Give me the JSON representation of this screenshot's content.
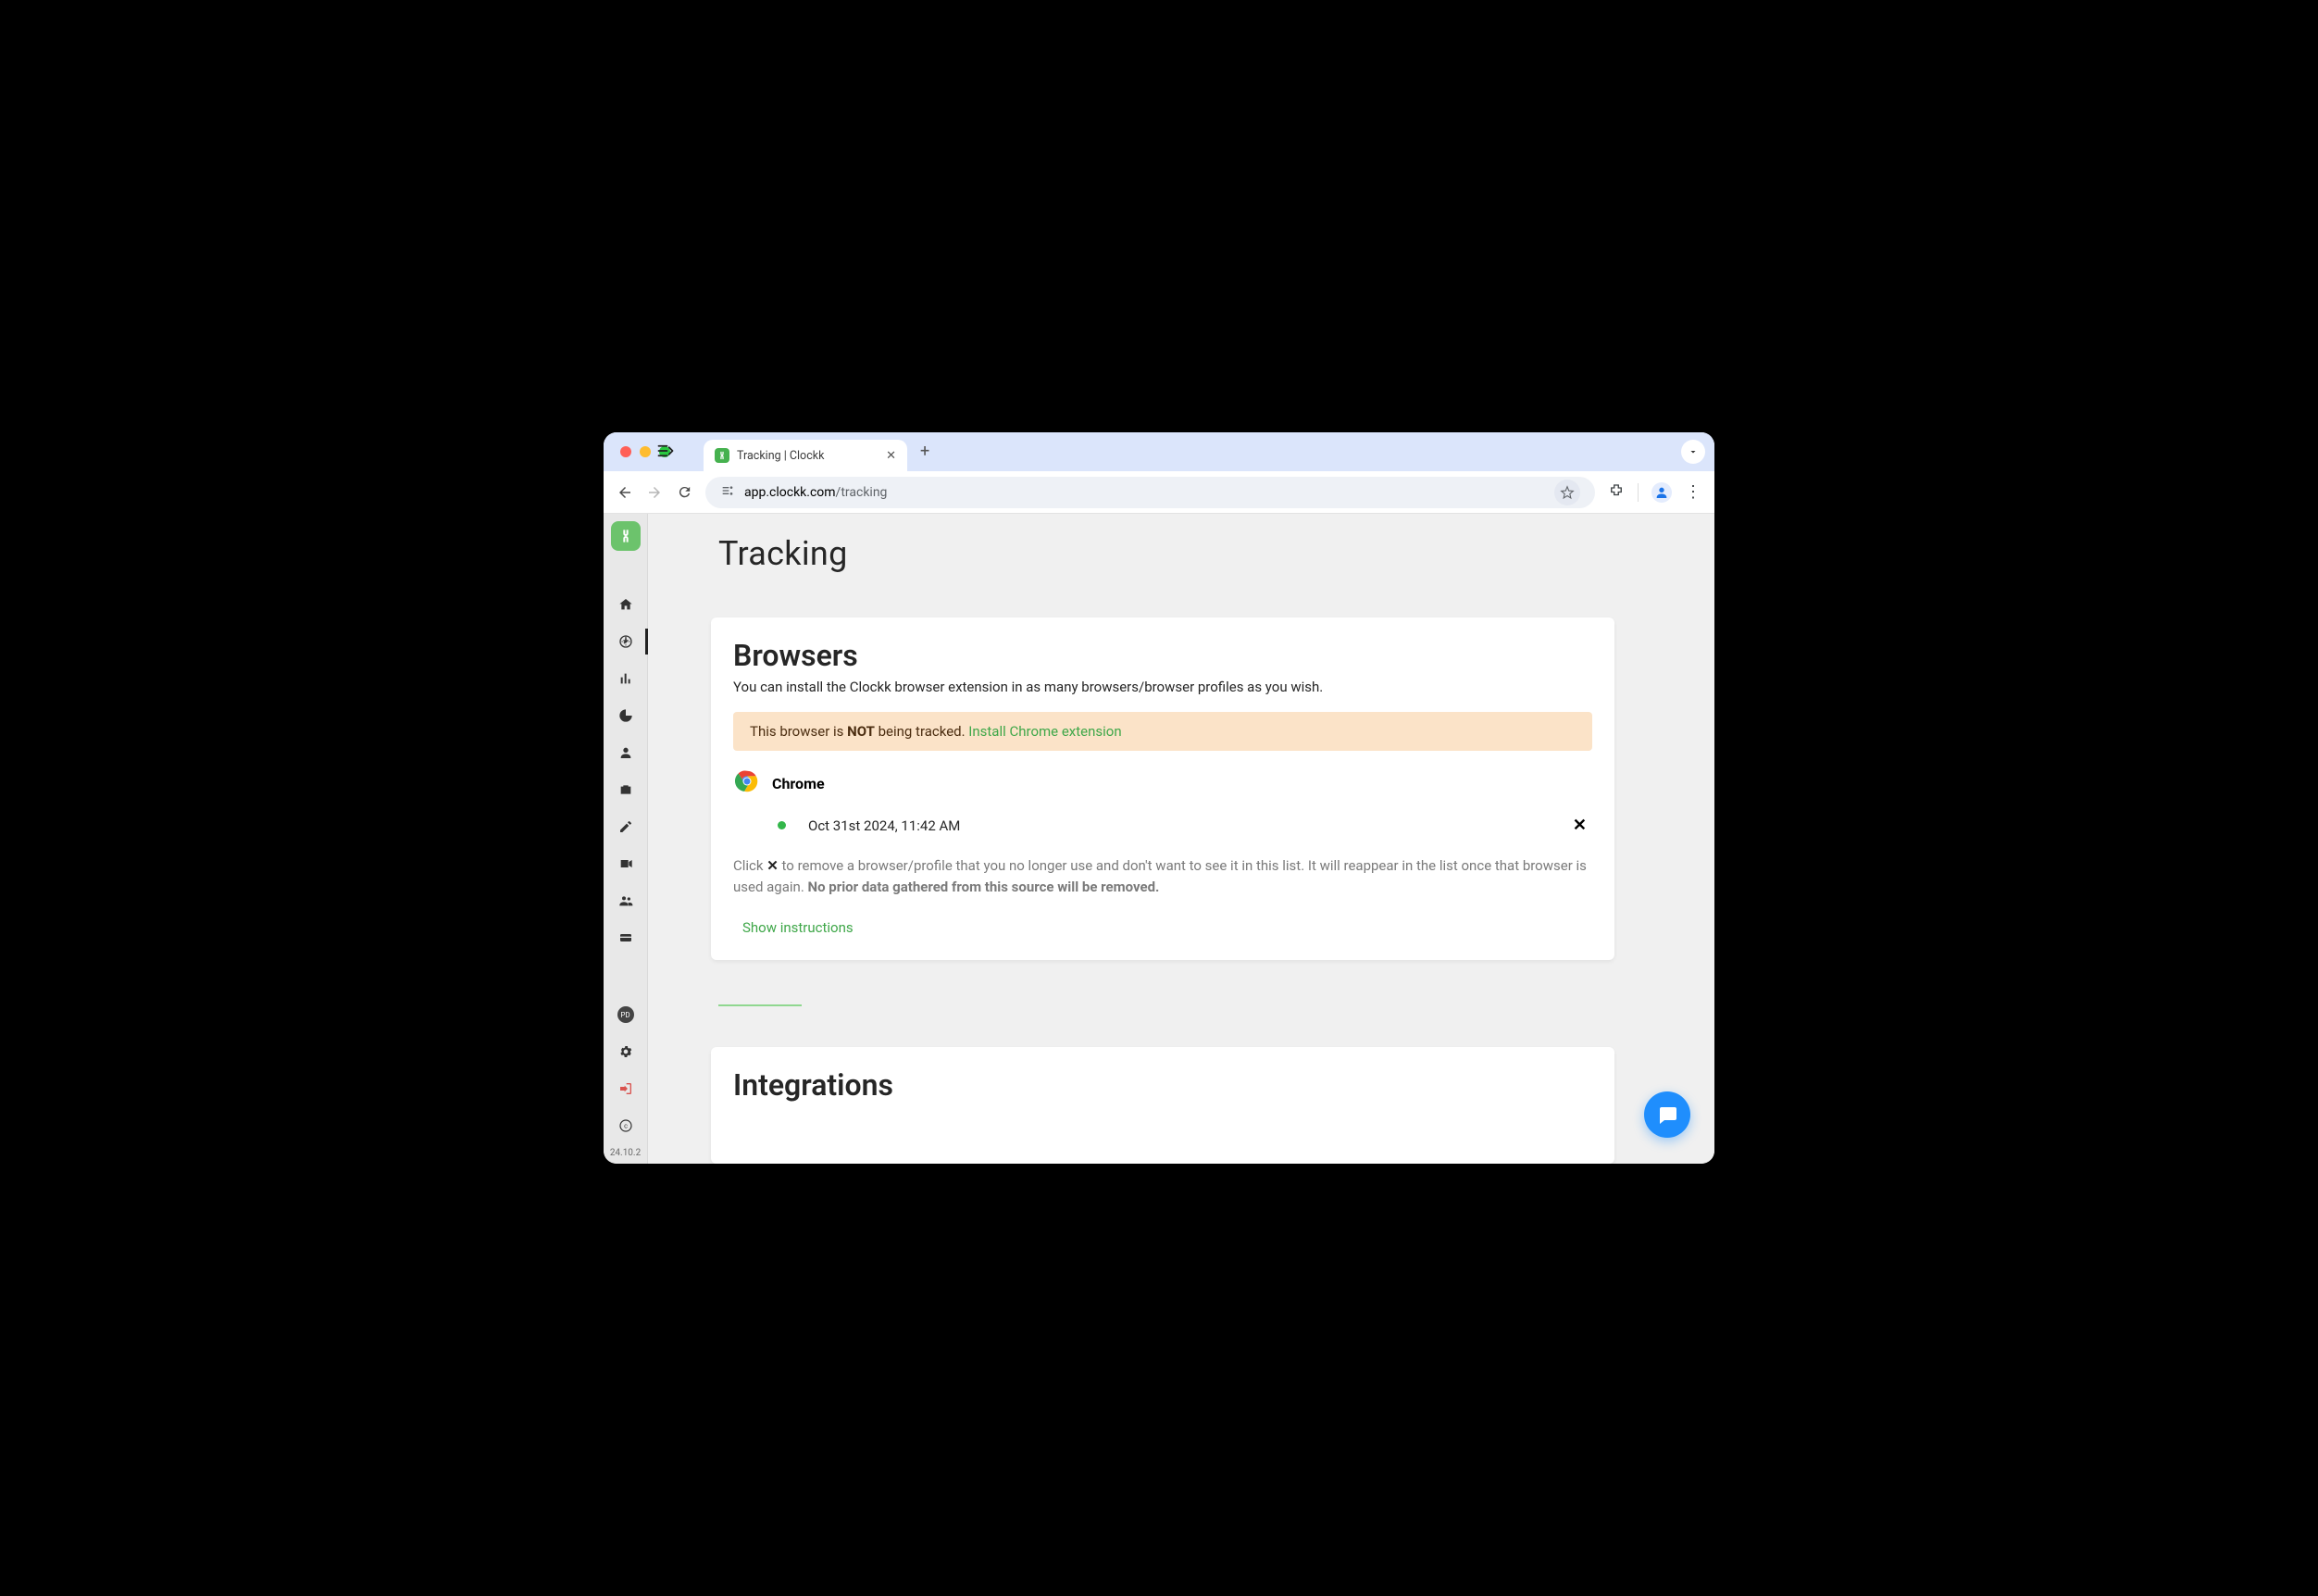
{
  "browser": {
    "tab_title": "Tracking | Clockk",
    "url_host": "app.clockk.com",
    "url_path": "/tracking"
  },
  "sidebar": {
    "version": "24.10.2",
    "pd_badge": "PD"
  },
  "page": {
    "title": "Tracking"
  },
  "browsers_card": {
    "heading": "Browsers",
    "subtitle": "You can install the Clockk browser extension in as many browsers/browser profiles as you wish.",
    "alert_prefix": "This browser is ",
    "alert_strong": "NOT",
    "alert_suffix": " being tracked. ",
    "alert_link": "Install Chrome extension",
    "browser_name": "Chrome",
    "instance_date": "Oct 31st 2024, 11:42 AM",
    "remove_pre": "Click ",
    "remove_x": "✕",
    "remove_mid": " to remove a browser/profile that you no longer use and don't want to see it in this list. It will reappear in the list once that browser is used again. ",
    "remove_strong": "No prior data gathered from this source will be removed.",
    "show_instructions": "Show instructions"
  },
  "integrations_card": {
    "heading": "Integrations"
  }
}
